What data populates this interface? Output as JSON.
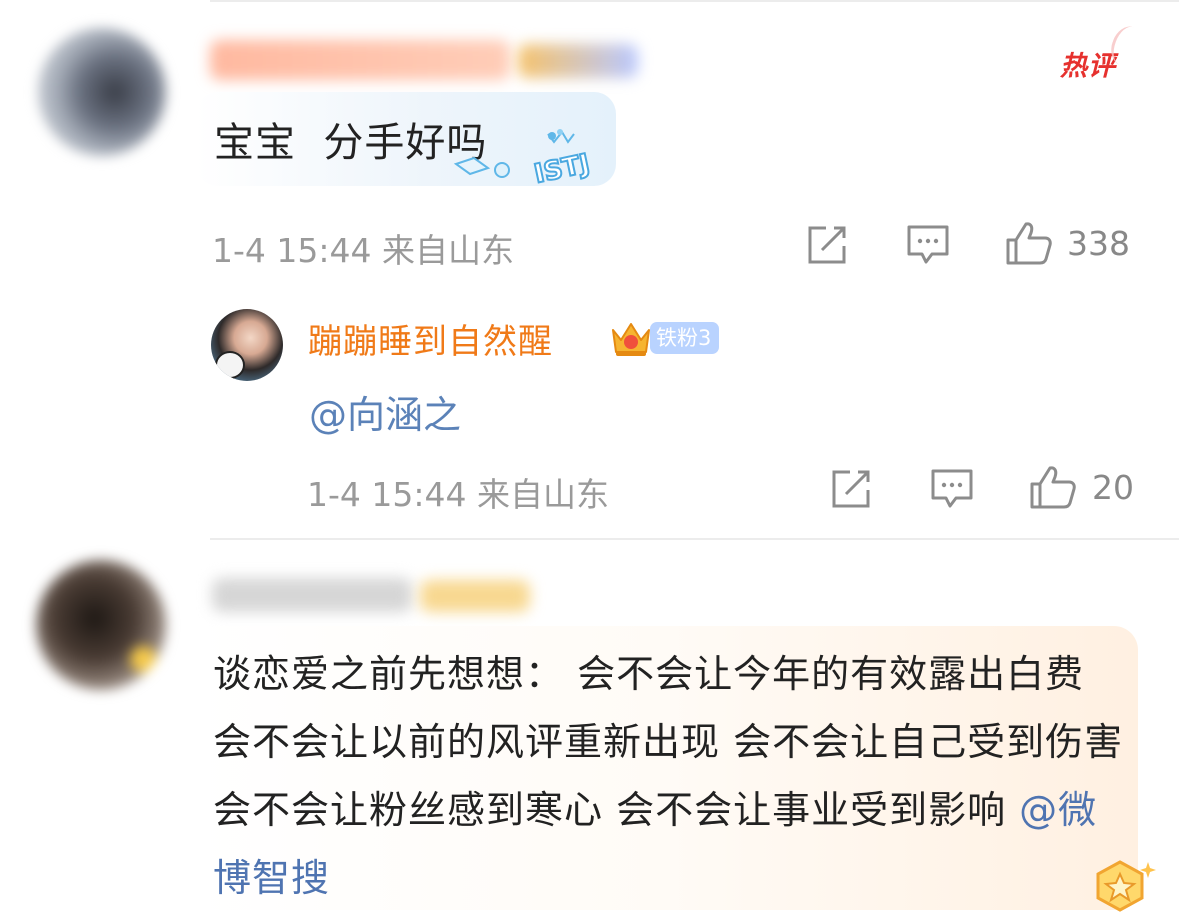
{
  "comment1": {
    "text": "宝宝  分手好吗",
    "hot_label": "热评",
    "decoration_label": "ISTJ",
    "time": "1-4 15:44",
    "location": "来自山东",
    "likes": "338"
  },
  "reply": {
    "username": "蹦蹦睡到自然醒",
    "fan_badge": "铁粉3",
    "text": "@向涵之",
    "time": "1-4 15:44",
    "location": "来自山东",
    "likes": "20"
  },
  "comment2": {
    "text_main": "谈恋爱之前先想想：  会不会让今年的有效露出白费 会不会让以前的风评重新出现 会不会让自己受到伤害 会不会让粉丝感到寒心 会不会让事业受到影响 ",
    "mention": "@微博智搜"
  },
  "icons": {
    "share": "share-icon",
    "comment": "comment-icon",
    "like": "thumbs-up-icon",
    "crown": "crown-icon",
    "vip": "vip-badge-icon"
  },
  "colors": {
    "hot": "#e6312e",
    "username": "#f07a18",
    "mention": "#5b82b8",
    "meta": "#9a9a9a"
  }
}
